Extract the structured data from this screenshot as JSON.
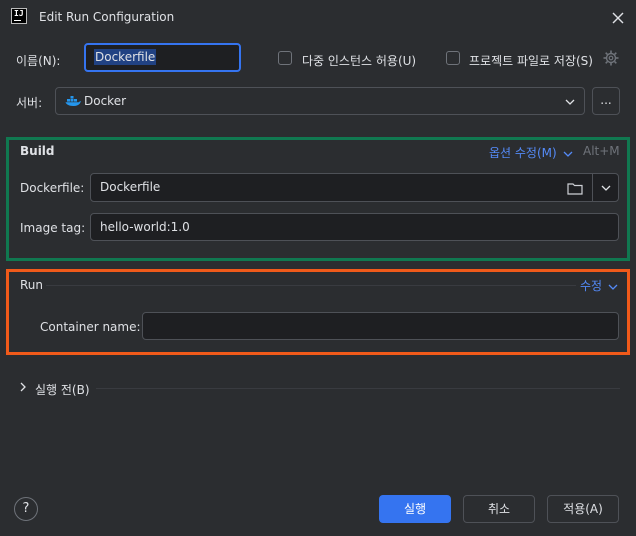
{
  "window": {
    "title": "Edit Run Configuration",
    "app_icon_text": "IJ"
  },
  "form": {
    "name_label": "이름(N):",
    "name_value": "Dockerfile",
    "allow_multiple_label": "다중 인스턴스 허용(U)",
    "store_as_file_label": "프로젝트 파일로 저장(S)",
    "server_label": "서버:",
    "server_value": "Docker",
    "more_button": "..."
  },
  "build": {
    "title": "Build",
    "modify_options": "옵션 수정(M)",
    "shortcut": "Alt+M",
    "dockerfile_label": "Dockerfile:",
    "dockerfile_value": "Dockerfile",
    "image_tag_label": "Image tag:",
    "image_tag_value": "hello-world:1.0"
  },
  "run": {
    "title": "Run",
    "modify": "수정",
    "container_name_label": "Container name:",
    "container_name_value": ""
  },
  "before_launch": {
    "label": "실행 전(B)"
  },
  "buttons": {
    "help": "?",
    "run": "실행",
    "cancel": "취소",
    "apply": "적용(A)"
  },
  "colors": {
    "accent": "#3574f0",
    "link": "#548af7",
    "highlight_build": "#107850",
    "highlight_run": "#f05a1a",
    "docker_blue": "#2496ed"
  }
}
